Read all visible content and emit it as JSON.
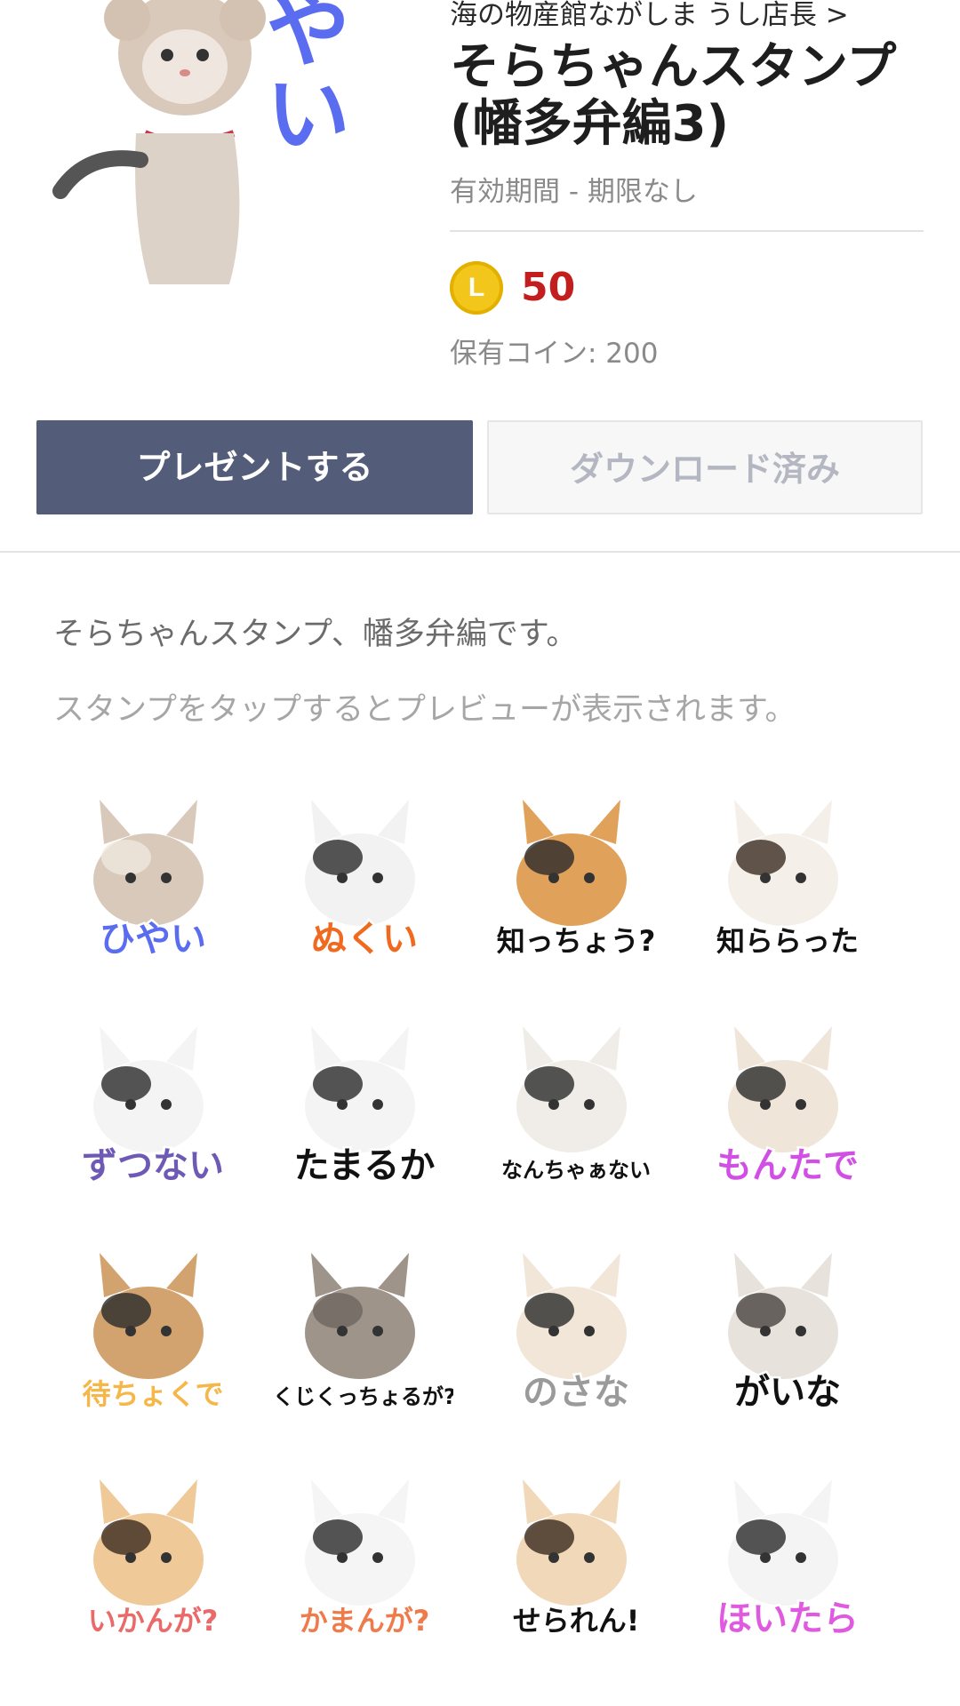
{
  "header": {
    "author": "海の物産館ながしま うし店長 >",
    "title": "そらちゃんスタンプ(幡多弁編3)",
    "validity": "有効期間 - 期限なし",
    "coin_symbol": "L",
    "price": "50",
    "coins_held": "保有コイン: 200"
  },
  "actions": {
    "present_label": "プレゼントする",
    "download_label": "ダウンロード済み"
  },
  "description": {
    "text": "そらちゃんスタンプ、幡多弁編です。",
    "hint": "スタンプをタップするとプレビューが表示されます。"
  },
  "hero": {
    "text": "ひやい",
    "color": "#5a6cf0"
  },
  "stickers": [
    {
      "text": "ひやい",
      "color": "#5a6cf0"
    },
    {
      "text": "ぬくい",
      "color": "#ef6a1e"
    },
    {
      "text": "知っちょう?",
      "color": "#111111"
    },
    {
      "text": "知ららった",
      "color": "#111111"
    },
    {
      "text": "ずつない",
      "color": "#6e59b5"
    },
    {
      "text": "たまるか",
      "color": "#111111"
    },
    {
      "text": "なんちゃぁない",
      "color": "#111111"
    },
    {
      "text": "もんたで",
      "color": "#d24fe6"
    },
    {
      "text": "待ちょくで",
      "color": "#f6b74a"
    },
    {
      "text": "くじくっちょるが?",
      "color": "#111111"
    },
    {
      "text": "のさな",
      "color": "#9a9a9a"
    },
    {
      "text": "がいな",
      "color": "#111111"
    },
    {
      "text": "いかんが?",
      "color": "#ea6a6a"
    },
    {
      "text": "かまんが?",
      "color": "#ef7a4a"
    },
    {
      "text": "せられん!",
      "color": "#111111"
    },
    {
      "text": "ほいたら",
      "color": "#e05adf"
    }
  ],
  "colors": {
    "present_button": "#535c78",
    "price_red": "#c31d1d",
    "coin_gold": "#f3c61b"
  }
}
